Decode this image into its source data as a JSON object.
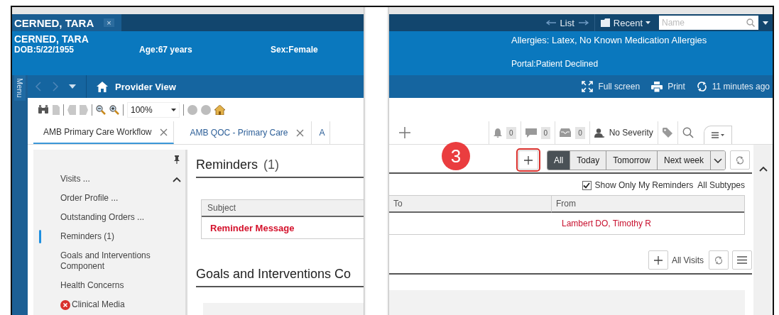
{
  "patient_tab": {
    "label": "CERNED, TARA",
    "close": "×"
  },
  "header_nav": {
    "list": "List",
    "recent": "Recent",
    "search": {
      "placeholder": "Name"
    }
  },
  "banner": {
    "name": "CERNED, TARA",
    "dob": "DOB:5/22/1955",
    "age": "Age:67 years",
    "sex": "Sex:Female",
    "allergies": "Allergies: Latex, No Known Medication Allergies",
    "portal": "Portal:Patient Declined"
  },
  "menu_label": "Menu",
  "nav": {
    "title": "Provider View",
    "actions": [
      {
        "kind": "fullscreen",
        "label": "Full screen"
      },
      {
        "kind": "print",
        "label": "Print"
      },
      {
        "kind": "refresh",
        "label": "11 minutes ago"
      }
    ]
  },
  "toolbar": {
    "zoom": "100%"
  },
  "tabs": [
    {
      "label": "AMB Primary Care Workflow",
      "selected": true
    },
    {
      "label": "AMB QOC - Primary Care",
      "selected": false
    },
    {
      "label": "A",
      "selected": false
    }
  ],
  "indicators": [
    {
      "kind": "bell",
      "count": "0"
    },
    {
      "kind": "message",
      "count": "0"
    },
    {
      "kind": "inbox",
      "count": "0"
    }
  ],
  "severity": "No Severity",
  "sidebar": {
    "items": [
      {
        "label": "Visits ...",
        "selected": false,
        "error": false
      },
      {
        "label": "Order Profile ...",
        "selected": false,
        "error": false
      },
      {
        "label": "Outstanding Orders ...",
        "selected": false,
        "error": false
      },
      {
        "label": "Reminders (1)",
        "selected": true,
        "error": false
      },
      {
        "label": "Goals and Interventions Component",
        "selected": false,
        "error": false
      },
      {
        "label": "Health Concerns",
        "selected": false,
        "error": false
      },
      {
        "label": "Clinical Media",
        "selected": false,
        "error": true
      }
    ]
  },
  "reminders": {
    "title": "Reminders",
    "count": "(1)",
    "callout": "3",
    "filters": [
      {
        "label": "All",
        "selected": true
      },
      {
        "label": "Today",
        "selected": false
      },
      {
        "label": "Tomorrow",
        "selected": false
      },
      {
        "label": "Next week",
        "selected": false
      }
    ],
    "show_only_mine": {
      "label": "Show Only My Reminders",
      "checked": true
    },
    "subtypes": "All Subtypes",
    "columns": [
      "Subject",
      "To",
      "From"
    ],
    "rows": [
      {
        "subject": "Reminder Message",
        "from": "Lambert DO, Timothy R"
      }
    ]
  },
  "goals": {
    "title": "Goals and Interventions Co",
    "filter": "All Visits"
  }
}
